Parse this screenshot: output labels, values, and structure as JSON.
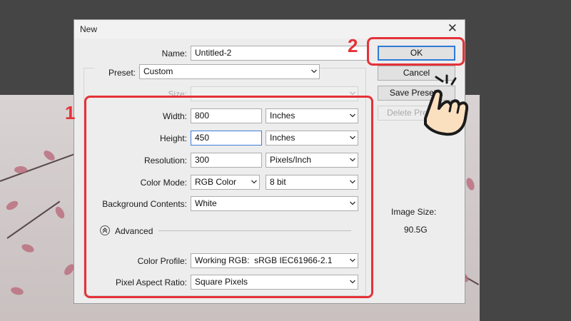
{
  "dialog": {
    "title": "New",
    "name_label": "Name:",
    "name_value": "Untitled-2",
    "preset_label": "Preset:",
    "preset_value": "Custom",
    "size_label": "Size:",
    "size_value": "",
    "width_label": "Width:",
    "width_value": "800",
    "width_unit": "Inches",
    "height_label": "Height:",
    "height_value": "450",
    "height_unit": "Inches",
    "resolution_label": "Resolution:",
    "resolution_value": "300",
    "resolution_unit": "Pixels/Inch",
    "color_mode_label": "Color Mode:",
    "color_mode_value": "RGB Color",
    "bit_depth_value": "8 bit",
    "background_label": "Background Contents:",
    "background_value": "White",
    "advanced_label": "Advanced",
    "color_profile_label": "Color Profile:",
    "color_profile_value": "Working RGB:  sRGB IEC61966-2.1",
    "pixel_aspect_label": "Pixel Aspect Ratio:",
    "pixel_aspect_value": "Square Pixels",
    "image_size_label": "Image Size:",
    "image_size_value": "90.5G"
  },
  "buttons": {
    "ok": "OK",
    "cancel": "Cancel",
    "save_preset": "Save Preset...",
    "delete_preset": "Delete Preset..."
  },
  "annotations": {
    "step1": "1",
    "step2": "2",
    "highlight_color": "#e53238",
    "accent_color": "#2f7ad6"
  },
  "icons": {
    "close": "close-icon",
    "chevron": "chevron-down-icon",
    "advanced_toggle": "double-chevron-up-icon",
    "hand": "pointing-hand-icon"
  }
}
